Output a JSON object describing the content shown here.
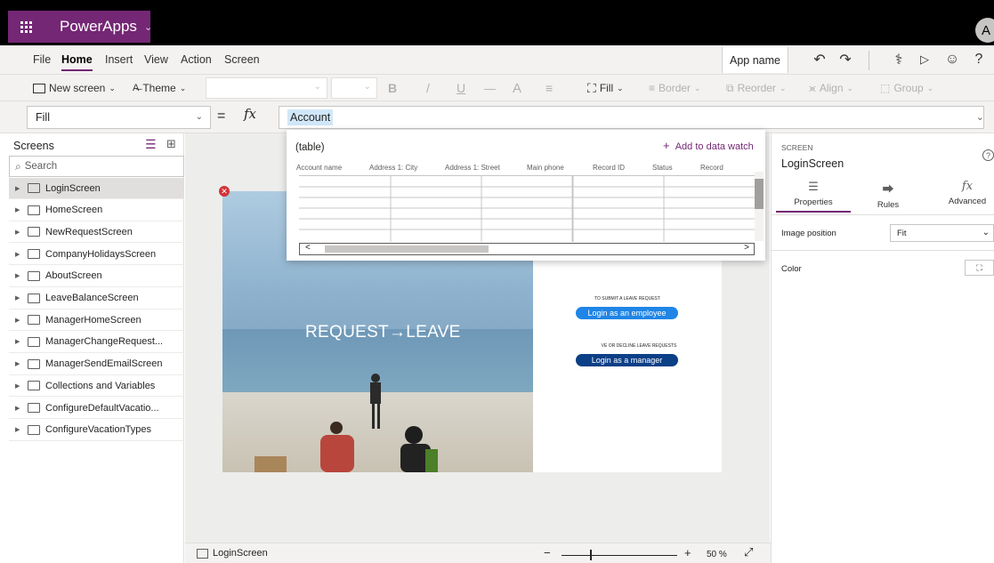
{
  "titlebar": {
    "app_label": "PowerApps",
    "avatar_letter": "A"
  },
  "menu": {
    "items": [
      "File",
      "Home",
      "Insert",
      "View",
      "Action",
      "Screen"
    ],
    "active": "Home",
    "app_name": "App name"
  },
  "ribbon": {
    "new_screen": "New screen",
    "theme": "Theme",
    "bold": "B",
    "italic": "/",
    "underline": "U",
    "strike": "—",
    "font_color": "A",
    "align_text": "≡",
    "fill": "Fill",
    "border": "Border",
    "reorder": "Reorder",
    "align": "Align",
    "group": "Group"
  },
  "formula": {
    "property": "Fill",
    "equals": "=",
    "fx": "fx",
    "value": "Account"
  },
  "left_panel": {
    "title": "Screens",
    "search_placeholder": "Search",
    "screens": [
      "LoginScreen",
      "HomeScreen",
      "NewRequestScreen",
      "CompanyHolidaysScreen",
      "AboutScreen",
      "LeaveBalanceScreen",
      "ManagerHomeScreen",
      "ManagerChangeRequest...",
      "ManagerSendEmailScreen",
      "Collections and Variables",
      "ConfigureDefaultVacatio...",
      "ConfigureVacationTypes"
    ],
    "selected": "LoginScreen"
  },
  "canvas": {
    "title": "REQUEST",
    "arrow": "→",
    "title_suffix": "LEAVE",
    "submit_text": "TO SUBMIT A LEAVE REQUEST",
    "employee_button": "Login as an employee",
    "decline_text": "VE OR DECLINE LEAVE REQUESTS",
    "manager_button": "Login as a manager"
  },
  "data_popup": {
    "title": "(table)",
    "add_watch": "Add to data watch",
    "columns": [
      "Account name",
      "Address 1: City",
      "Address 1: Street",
      "Main phone",
      "Record ID",
      "Status",
      "Record"
    ]
  },
  "right_panel": {
    "kicker": "SCREEN",
    "screen_name": "LoginScreen",
    "tabs": [
      "Properties",
      "Rules",
      "Advanced"
    ],
    "active_tab": "Properties",
    "image_position_label": "Image position",
    "image_position_value": "Fit",
    "color_label": "Color"
  },
  "status_bar": {
    "screen": "LoginScreen",
    "zoom_minus": "−",
    "zoom_plus": "+",
    "zoom_value": "50 %"
  },
  "colors": {
    "brand": "#742774",
    "employee_button": "#1f85e6",
    "manager_button": "#0b3f86",
    "error": "#d13438"
  }
}
